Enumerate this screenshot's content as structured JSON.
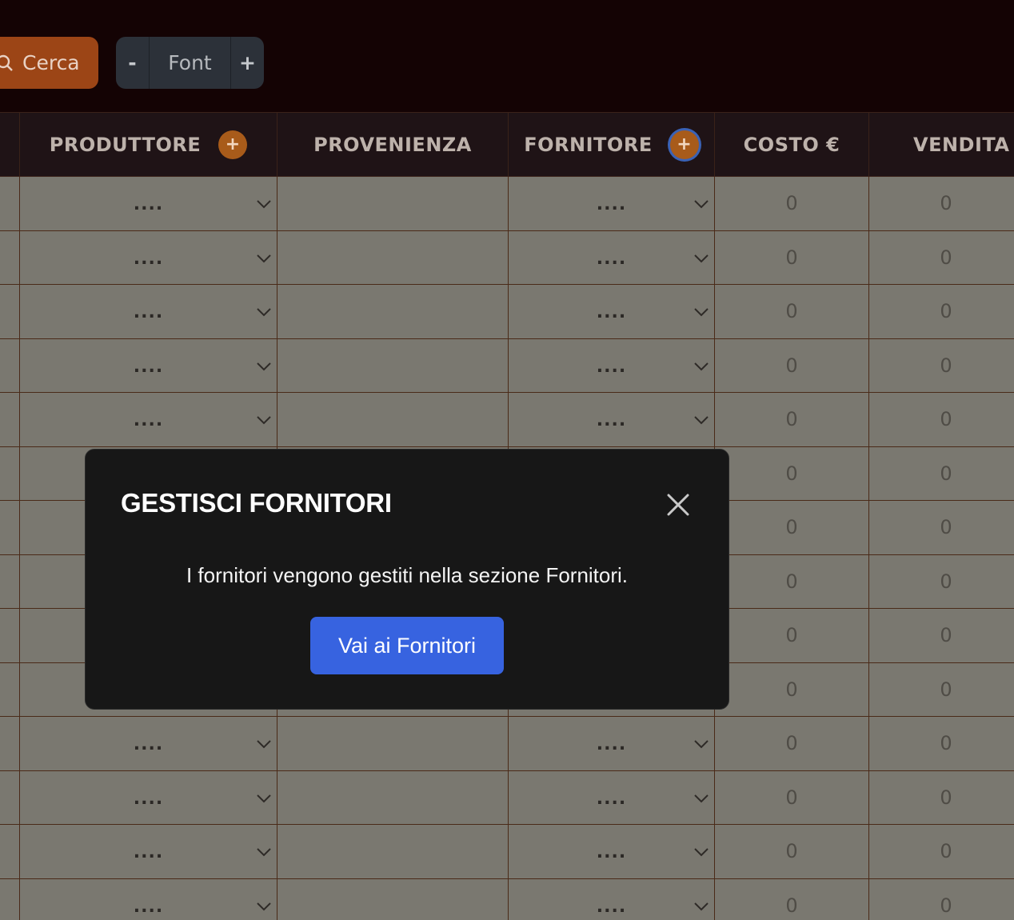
{
  "toolbar": {
    "search_label": "Cerca",
    "font_decrease": "-",
    "font_label": "Font",
    "font_increase": "+"
  },
  "table": {
    "headers": [
      "PRODUTTORE",
      "PROVENIENZA",
      "FORNITORE",
      "COSTO €",
      "VENDITA €"
    ],
    "add_glyph": "+",
    "select_placeholder": "....",
    "rows": [
      {
        "costo": "0",
        "vendita": "0"
      },
      {
        "costo": "0",
        "vendita": "0"
      },
      {
        "costo": "0",
        "vendita": "0"
      },
      {
        "costo": "0",
        "vendita": "0"
      },
      {
        "costo": "0",
        "vendita": "0"
      },
      {
        "costo": "0",
        "vendita": "0"
      },
      {
        "costo": "0",
        "vendita": "0"
      },
      {
        "costo": "0",
        "vendita": "0"
      },
      {
        "costo": "0",
        "vendita": "0"
      },
      {
        "costo": "0",
        "vendita": "0"
      },
      {
        "costo": "0",
        "vendita": "0"
      },
      {
        "costo": "0",
        "vendita": "0"
      },
      {
        "costo": "0",
        "vendita": "0"
      },
      {
        "costo": "0",
        "vendita": "0"
      }
    ]
  },
  "modal": {
    "title": "GESTISCI FORNITORI",
    "message": "I fornitori vengono gestiti nella sezione Fornitori.",
    "button_label": "Vai ai Fornitori"
  },
  "colors": {
    "accent_orange": "#9c4516",
    "primary_blue": "#3763e0",
    "modal_bg": "#171717"
  }
}
